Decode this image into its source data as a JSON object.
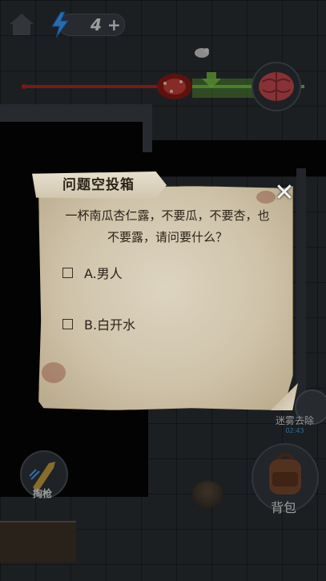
{
  "hud": {
    "energy_count": "4",
    "energy_plus": "+"
  },
  "dialog": {
    "title": "问题空投箱",
    "close_symbol": "✕",
    "question": "一杯南瓜杏仁露，不要瓜，不要杏，也不要露，请问要什么？",
    "options": [
      {
        "label": "A.男人"
      },
      {
        "label": "B.白开水"
      }
    ]
  },
  "controls": {
    "fog_label": "迷雾去除",
    "fog_timer": "02:43",
    "bag_label": "背包",
    "gun_label": "掏枪"
  },
  "colors": {
    "parchment": "#d8cfba",
    "fog_timer": "#4aa0d8",
    "red_bar": "#b5261e",
    "green_bar": "#6bbf3a"
  },
  "icons": [
    "home-icon",
    "lightning-icon",
    "close-icon",
    "fog-icon",
    "backpack-icon",
    "bullet-icon",
    "bird-icon",
    "brain-icon"
  ]
}
